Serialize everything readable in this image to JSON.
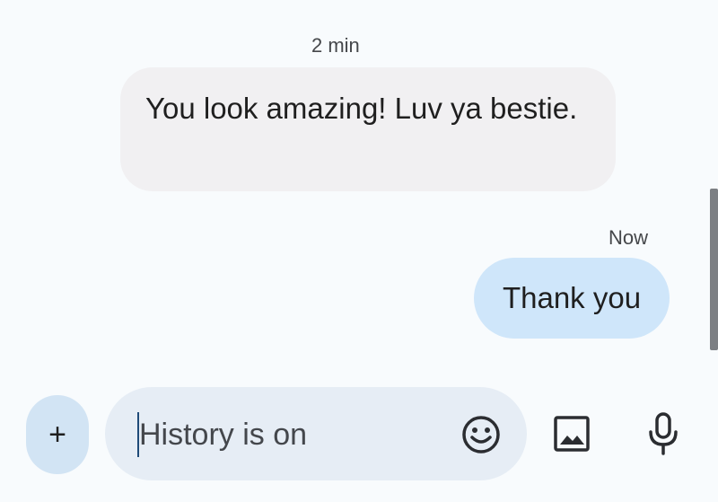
{
  "conversation": {
    "messages": [
      {
        "direction": "incoming",
        "timestamp": "2 min",
        "text": "You look amazing! Luv ya bestie."
      },
      {
        "direction": "outgoing",
        "timestamp": "Now",
        "text": "Thank you"
      }
    ]
  },
  "composer": {
    "add_label": "+",
    "placeholder": "History is on",
    "value": ""
  },
  "icons": {
    "add": "plus-icon",
    "emoji": "emoji-icon",
    "gallery": "image-icon",
    "voice": "microphone-icon"
  },
  "colors": {
    "background": "#f8fbfd",
    "incoming_bubble": "#f1f0f2",
    "outgoing_bubble": "#cfe6fa",
    "compose_field": "#e6edf5",
    "add_button": "#d2e4f4"
  }
}
